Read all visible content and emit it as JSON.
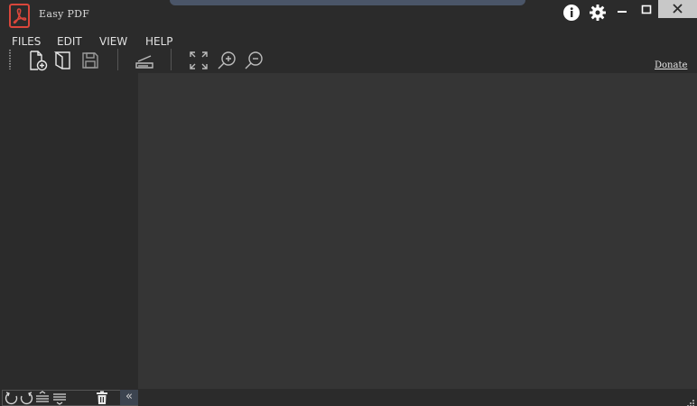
{
  "window": {
    "title": "Easy PDF"
  },
  "menu": {
    "items": [
      "FILES",
      "EDIT",
      "VIEW",
      "HELP"
    ]
  },
  "toolbar": {
    "donate_label": "Donate",
    "tools": [
      "add-file-icon",
      "open-file-icon",
      "save-icon",
      "scanner-icon",
      "fit-screen-icon",
      "zoom-in-icon",
      "zoom-out-icon"
    ]
  },
  "bottombar": {
    "collapse_label": "«",
    "tools": [
      "rotate-left-icon",
      "rotate-right-icon",
      "move-up-icon",
      "move-down-icon",
      "delete-icon"
    ]
  },
  "colors": {
    "background": "#2b2b2b",
    "canvas": "#353535",
    "logo_red": "#d9463b",
    "icon_light": "#e8e8e8",
    "icon_dim": "#bcbcbc"
  }
}
